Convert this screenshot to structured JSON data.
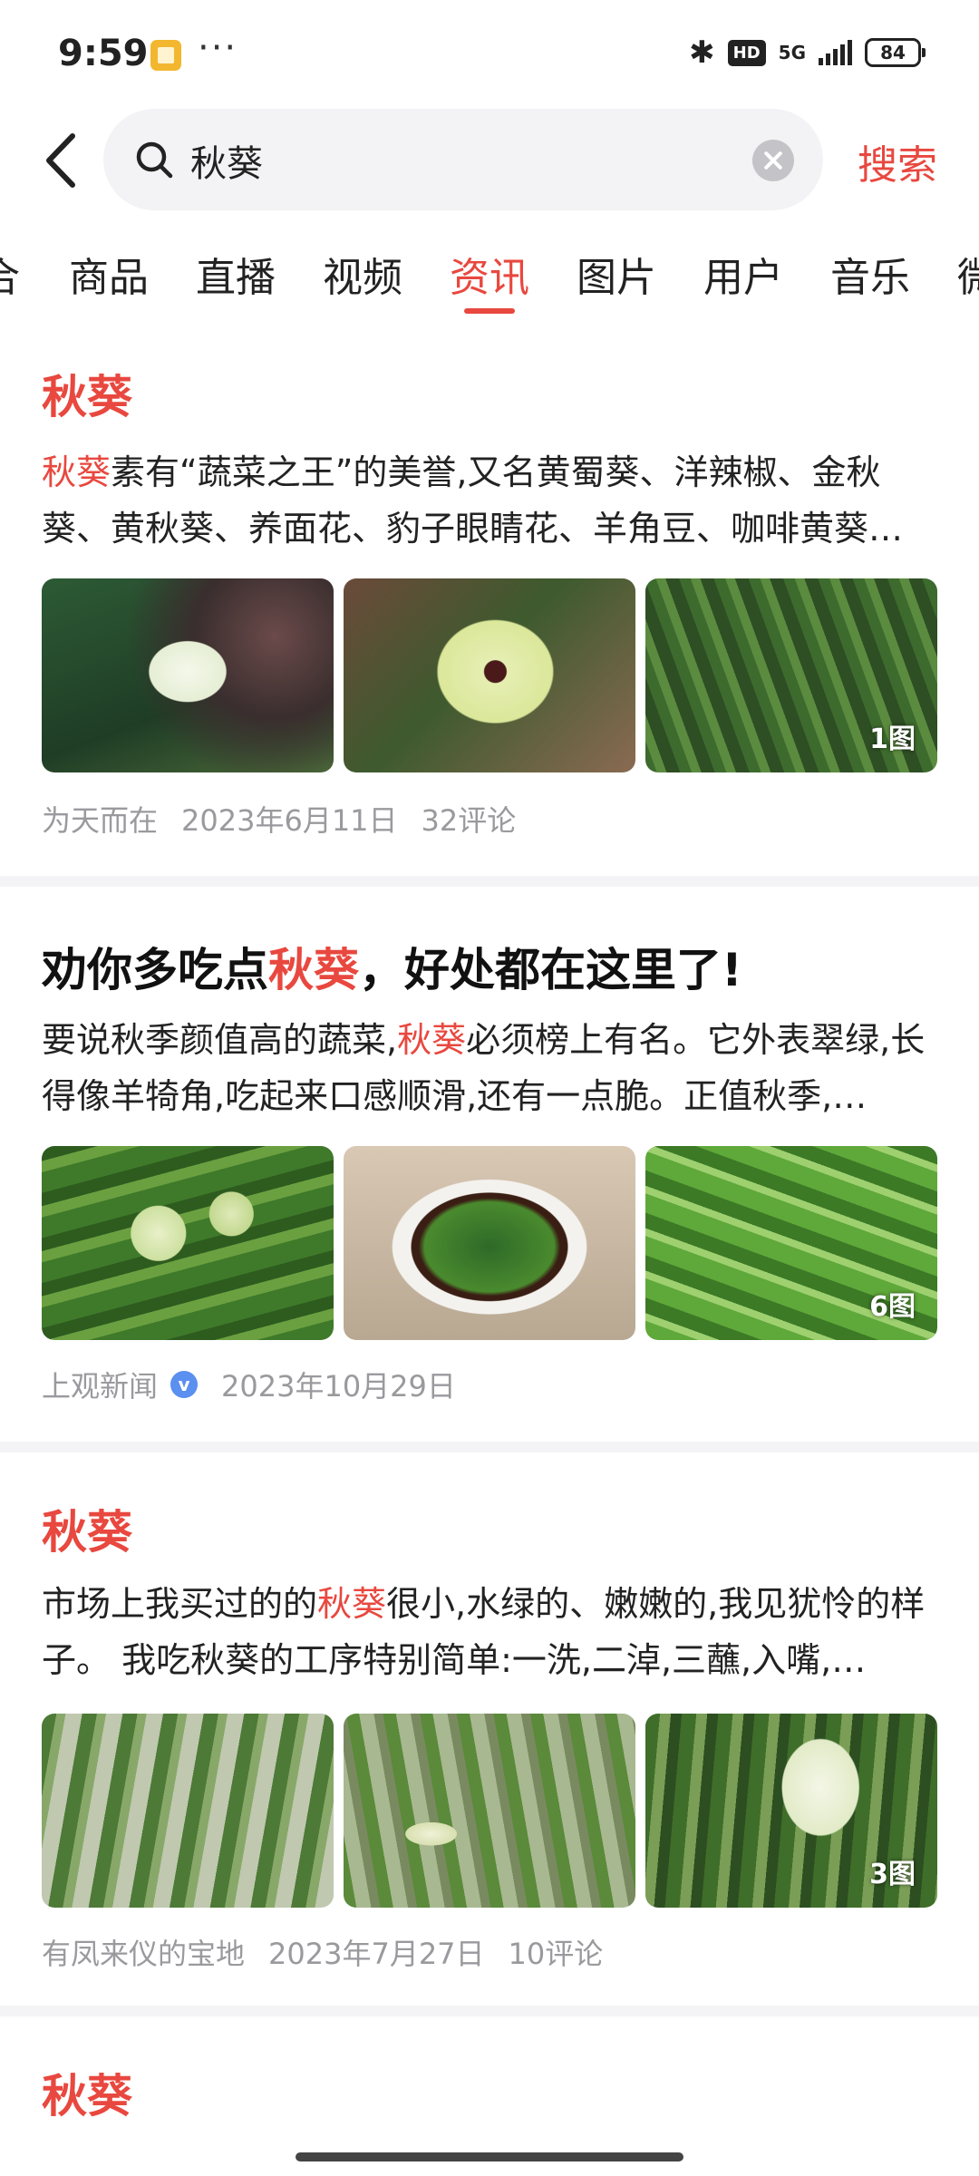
{
  "status_bar": {
    "time": "9:59",
    "dots": "···",
    "hd": "HD",
    "network": "5G",
    "battery": "84"
  },
  "search": {
    "query": "秋葵",
    "button_label": "搜索"
  },
  "tabs": [
    {
      "label": "合"
    },
    {
      "label": "商品"
    },
    {
      "label": "直播"
    },
    {
      "label": "视频"
    },
    {
      "label": "资讯",
      "active": true
    },
    {
      "label": "图片"
    },
    {
      "label": "用户"
    },
    {
      "label": "音乐"
    },
    {
      "label": "微"
    }
  ],
  "highlight_color": "#e8483f",
  "results": [
    {
      "title_before": "",
      "title_hl": "秋葵",
      "title_after": "",
      "desc_hl": "秋葵",
      "desc_rest": "素有“蔬菜之王”的美誉,又名黄蜀葵、洋辣椒、金秋葵、黄秋葵、养面花、豹子眼睛花、羊角豆、咖啡黄葵…",
      "image_count": "1图",
      "author": "为天而在",
      "date": "2023年6月11日",
      "comments": "32评论"
    },
    {
      "title_before": "劝你多吃点",
      "title_hl": "秋葵",
      "title_after": "，好处都在这里了!",
      "desc_before": "要说秋季颜值高的蔬菜,",
      "desc_hl": "秋葵",
      "desc_rest": "必须榜上有名。它外表翠绿,长得像羊犄角,吃起来口感顺滑,还有一点脆。正值秋季,…",
      "image_count": "6图",
      "author": "上观新闻",
      "verified_mark": "v",
      "date": "2023年10月29日"
    },
    {
      "title_before": "",
      "title_hl": "秋葵",
      "title_after": "",
      "desc_before": "市场上我买过的的",
      "desc_hl": "秋葵",
      "desc_rest": "很小,水绿的、嫩嫩的,我见犹怜的样子。 我吃秋葵的工序特别简单:一洗,二淖,三蘸,入嘴,…",
      "image_count": "3图",
      "author": "有凤来仪的宝地",
      "date": "2023年7月27日",
      "comments": "10评论"
    },
    {
      "title_before": "",
      "title_hl": "秋葵",
      "title_after": ""
    }
  ]
}
